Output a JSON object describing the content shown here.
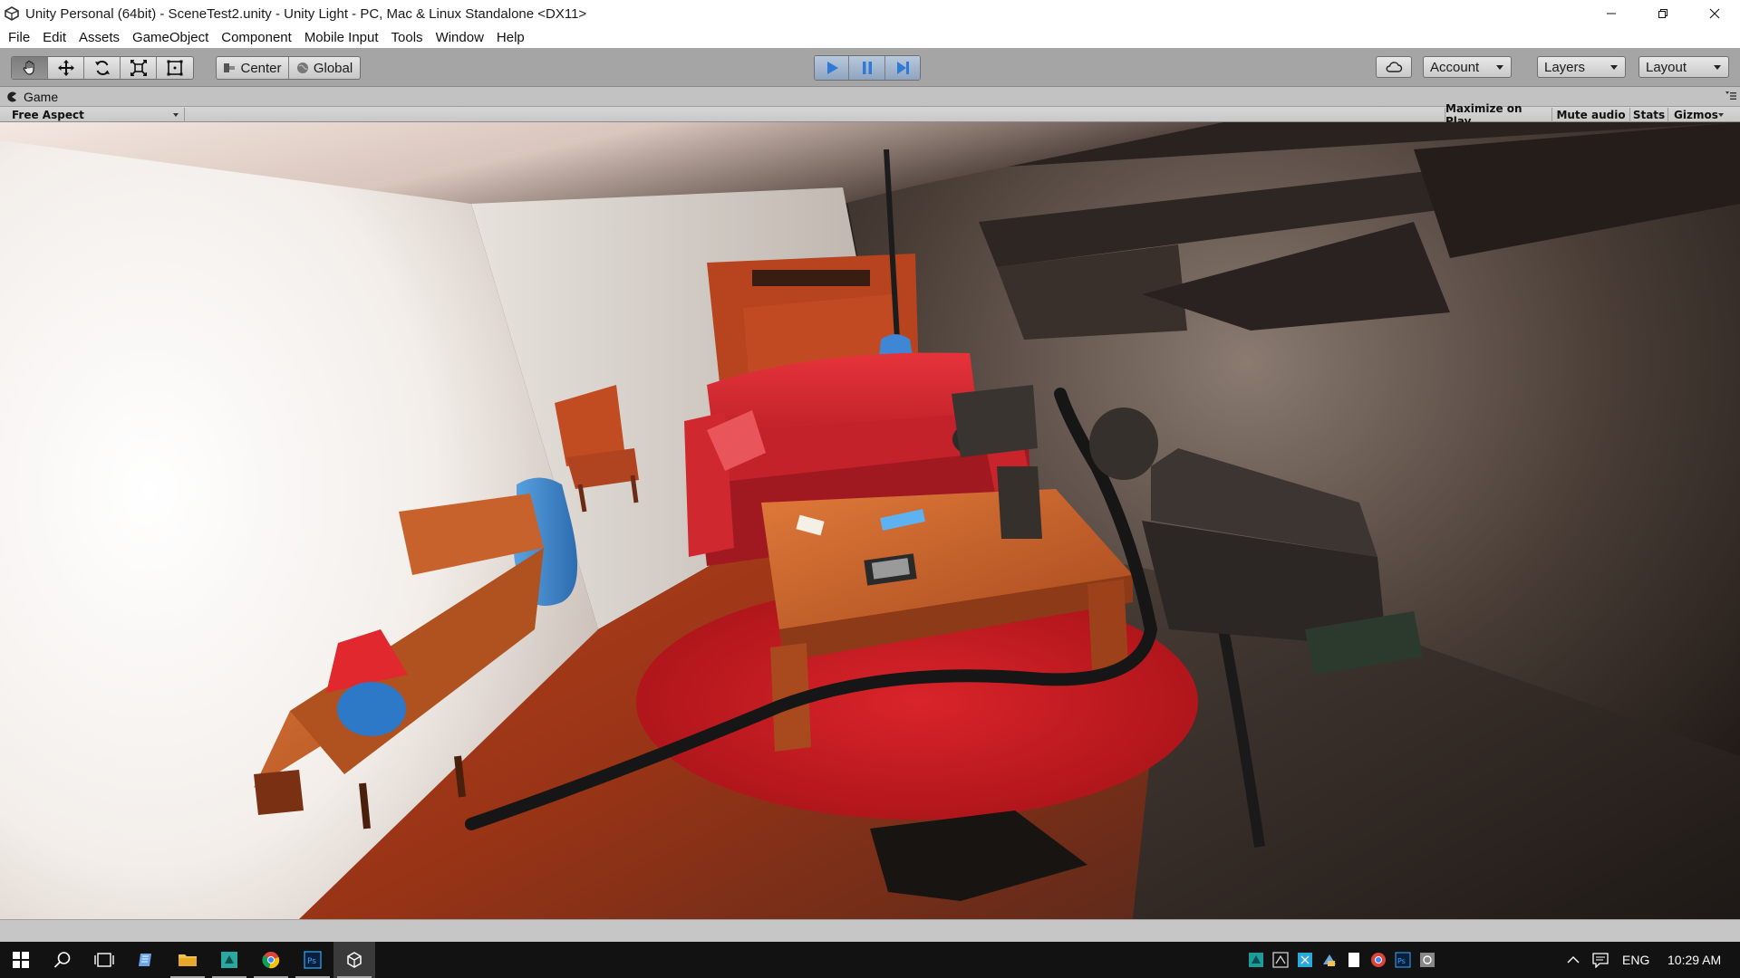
{
  "window": {
    "title": "Unity Personal (64bit) - SceneTest2.unity - Unity Light - PC, Mac & Linux Standalone <DX11>",
    "app_icon": "unity-icon",
    "controls": [
      "minimize-icon",
      "restore-icon",
      "close-icon"
    ]
  },
  "menu": {
    "items": [
      "File",
      "Edit",
      "Assets",
      "GameObject",
      "Component",
      "Mobile Input",
      "Tools",
      "Window",
      "Help"
    ]
  },
  "toolbar": {
    "transform_tools": [
      "hand-icon",
      "move-icon",
      "rotate-icon",
      "scale-icon",
      "rect-icon"
    ],
    "pivot_label": "Center",
    "space_label": "Global",
    "play_controls": [
      "play-icon",
      "pause-icon",
      "step-icon"
    ],
    "play_active": true,
    "cloud_icon": "cloud-icon",
    "account_label": "Account",
    "layers_label": "Layers",
    "layout_label": "Layout"
  },
  "game_panel": {
    "tab_label": "Game",
    "aspect_label": "Free Aspect",
    "maximize_label": "Maximize on Play",
    "mute_label": "Mute audio",
    "stats_label": "Stats",
    "gizmos_label": "Gizmos"
  },
  "taskbar": {
    "apps": [
      "windows-start-icon",
      "search-icon",
      "task-view-icon",
      "notepad-icon",
      "file-explorer-icon",
      "store-app-icon",
      "chrome-icon",
      "photoshop-icon",
      "unity-icon"
    ],
    "tray_icons": [
      "app-tray-icon",
      "tray-icon-2",
      "tray-icon-3",
      "tray-icon-4",
      "tray-icon-5",
      "chrome-tray-icon",
      "photoshop-tray-icon",
      "tray-icon-8"
    ],
    "language": "ENG",
    "clock": "10:29 AM"
  },
  "colors": {
    "toolbar_bg": "#a5a5a5",
    "play_active": "#4d8ad9",
    "taskbar_bg": "#121212"
  }
}
